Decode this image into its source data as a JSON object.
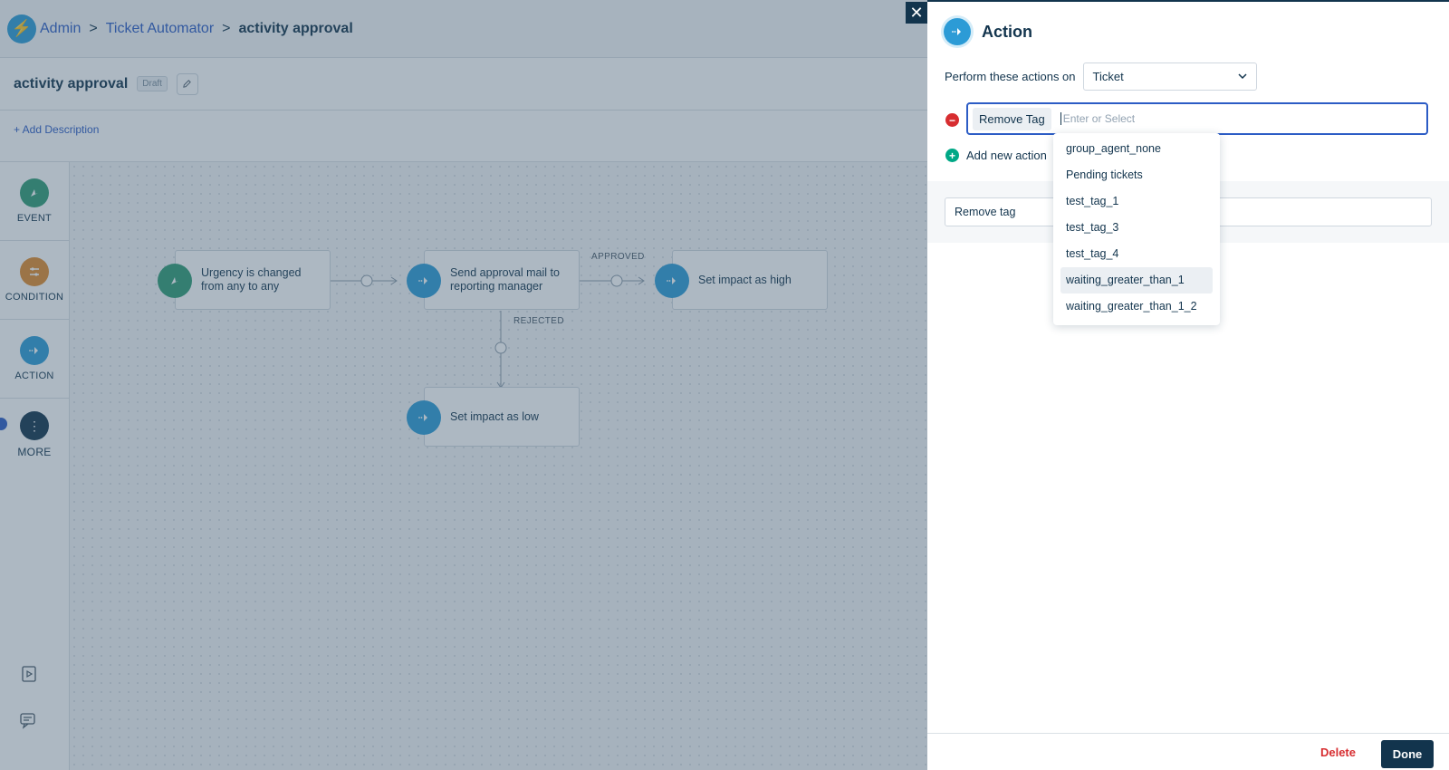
{
  "breadcrumb": {
    "admin": "Admin",
    "automator": "Ticket Automator",
    "current": "activity approval",
    "separator": ">"
  },
  "workflow": {
    "title": "activity approval",
    "status": "Draft",
    "add_description": "+ Add Description"
  },
  "palette": {
    "event": "EVENT",
    "condition": "CONDITION",
    "action": "ACTION",
    "more": "MORE"
  },
  "canvas": {
    "nodes": {
      "event": "Urgency is changed from any to any",
      "approval": "Send approval mail to reporting manager",
      "high": "Set impact as high",
      "low": "Set impact as low"
    },
    "labels": {
      "approved": "APPROVED",
      "rejected": "REJECTED"
    }
  },
  "panel": {
    "title": "Action",
    "perform_label": "Perform these actions on",
    "perform_value": "Ticket",
    "action_chip": "Remove Tag",
    "input_placeholder": "Enter or Select",
    "add_action": "Add new action",
    "remove_tag_field": "Remove tag",
    "dropdown_options": [
      "group_agent_none",
      "Pending tickets",
      "test_tag_1",
      "test_tag_3",
      "test_tag_4",
      "waiting_greater_than_1",
      "waiting_greater_than_1_2"
    ],
    "highlighted_option": "waiting_greater_than_1",
    "delete_label": "Delete",
    "done_label": "Done"
  },
  "colors": {
    "primary_dark": "#12344d",
    "link_blue": "#2c5cc5",
    "event_green": "#2f9c74",
    "condition_orange": "#e08a2b",
    "action_blue": "#2c9bd6",
    "delete_red": "#d72d30"
  },
  "icons": {
    "logo": "lightning-bolt-icon",
    "event": "cursor-click-icon",
    "condition": "sliders-icon",
    "action": "arrow-right-icon",
    "more": "vertical-dots-icon",
    "close": "close-icon"
  }
}
